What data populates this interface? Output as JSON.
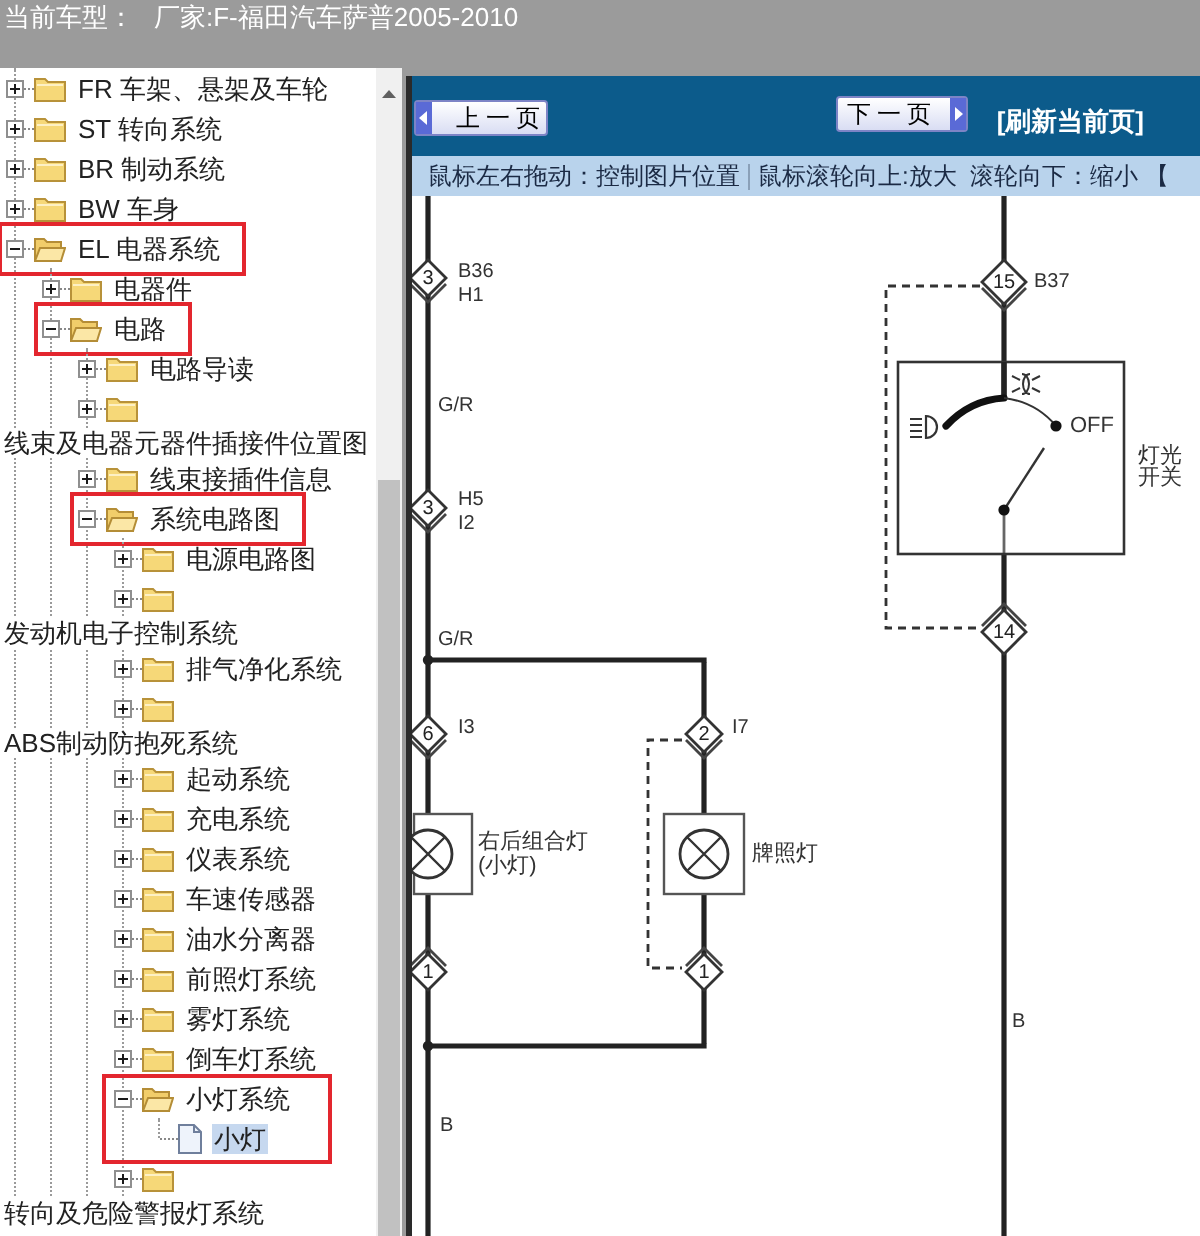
{
  "header": {
    "label": "当前车型：",
    "vehicle": "厂家:F-福田汽车萨普2005-2010"
  },
  "tree": [
    {
      "kind": "folder",
      "label": "FR 车架、悬架及车轮",
      "expanded": false,
      "selected": false,
      "highlighted": false
    },
    {
      "kind": "folder",
      "label": "ST 转向系统",
      "expanded": false,
      "selected": false,
      "highlighted": false
    },
    {
      "kind": "folder",
      "label": "BR 制动系统",
      "expanded": false,
      "selected": false,
      "highlighted": false
    },
    {
      "kind": "folder",
      "label": "BW 车身",
      "expanded": false,
      "selected": false,
      "highlighted": false
    },
    {
      "kind": "folder",
      "label": "EL 电器系统",
      "expanded": true,
      "selected": false,
      "highlighted": true,
      "children": [
        {
          "kind": "folder",
          "label": "电器件",
          "expanded": false,
          "selected": false,
          "highlighted": false
        },
        {
          "kind": "folder",
          "label": "电路",
          "expanded": true,
          "selected": false,
          "highlighted": true,
          "children": [
            {
              "kind": "folder",
              "label": "电路导读",
              "expanded": false,
              "selected": false,
              "highlighted": false
            },
            {
              "kind": "folder",
              "expanded": false,
              "selected": false,
              "highlighted": false
            },
            {
              "kind": "caption",
              "label": "线束及电器元器件插接件位置图"
            },
            {
              "kind": "folder",
              "label": "线束接插件信息",
              "expanded": false,
              "selected": false,
              "highlighted": false
            },
            {
              "kind": "folder",
              "label": "系统电路图",
              "expanded": true,
              "selected": false,
              "highlighted": true,
              "children": [
                {
                  "kind": "folder",
                  "label": "电源电路图",
                  "expanded": false,
                  "selected": false,
                  "highlighted": false
                },
                {
                  "kind": "folder",
                  "expanded": false,
                  "selected": false,
                  "highlighted": false
                },
                {
                  "kind": "caption",
                  "label": "发动机电子控制系统"
                },
                {
                  "kind": "folder",
                  "label": "排气净化系统",
                  "expanded": false,
                  "selected": false,
                  "highlighted": false
                },
                {
                  "kind": "folder",
                  "expanded": false,
                  "selected": false,
                  "highlighted": false
                },
                {
                  "kind": "caption",
                  "label": "ABS制动防抱死系统"
                },
                {
                  "kind": "folder",
                  "label": "起动系统",
                  "expanded": false,
                  "selected": false,
                  "highlighted": false
                },
                {
                  "kind": "folder",
                  "label": "充电系统",
                  "expanded": false,
                  "selected": false,
                  "highlighted": false
                },
                {
                  "kind": "folder",
                  "label": "仪表系统",
                  "expanded": false,
                  "selected": false,
                  "highlighted": false
                },
                {
                  "kind": "folder",
                  "label": "车速传感器",
                  "expanded": false,
                  "selected": false,
                  "highlighted": false
                },
                {
                  "kind": "folder",
                  "label": "油水分离器",
                  "expanded": false,
                  "selected": false,
                  "highlighted": false
                },
                {
                  "kind": "folder",
                  "label": "前照灯系统",
                  "expanded": false,
                  "selected": false,
                  "highlighted": false
                },
                {
                  "kind": "folder",
                  "label": "雾灯系统",
                  "expanded": false,
                  "selected": false,
                  "highlighted": false
                },
                {
                  "kind": "folder",
                  "label": "倒车灯系统",
                  "expanded": false,
                  "selected": false,
                  "highlighted": false
                },
                {
                  "kind": "folder",
                  "label": "小灯系统",
                  "expanded": true,
                  "selected": false,
                  "highlighted": true,
                  "children": [
                    {
                      "kind": "file",
                      "label": "小灯",
                      "selected": true,
                      "highlighted": true
                    }
                  ]
                },
                {
                  "kind": "folder",
                  "expanded": false,
                  "selected": false,
                  "highlighted": false
                },
                {
                  "kind": "caption",
                  "label": "转向及危险警报灯系统"
                }
              ]
            }
          ]
        }
      ]
    }
  ],
  "toolbar": {
    "prev_button": "上一页",
    "next_button": "下一页",
    "refresh_link": "[刷新当前页]"
  },
  "hint_bar": [
    "鼠标左右拖动：控制图片位置",
    "鼠标滚轮向上:放大  滚轮向下：缩小 【"
  ],
  "diagram": {
    "connectors": [
      {
        "number": "3",
        "codes": [
          "B36",
          "H1"
        ]
      },
      {
        "number": "3",
        "codes": [
          "H5",
          "I2"
        ]
      },
      {
        "number": "6",
        "codes": [
          "I3"
        ]
      },
      {
        "number": "2",
        "codes": [
          "I7"
        ]
      },
      {
        "number": "1"
      },
      {
        "number": "1"
      },
      {
        "number": "15",
        "codes": [
          "B37"
        ]
      },
      {
        "number": "14"
      }
    ],
    "wire_labels": [
      "G/R",
      "G/R",
      "B",
      "B"
    ],
    "lamps": [
      {
        "label_lines": [
          "右后组合灯",
          "(小灯)"
        ]
      },
      {
        "label_lines": [
          "牌照灯"
        ]
      }
    ],
    "light_switch": {
      "position_label": "OFF",
      "label_lines": [
        "灯光",
        "开关"
      ]
    }
  }
}
